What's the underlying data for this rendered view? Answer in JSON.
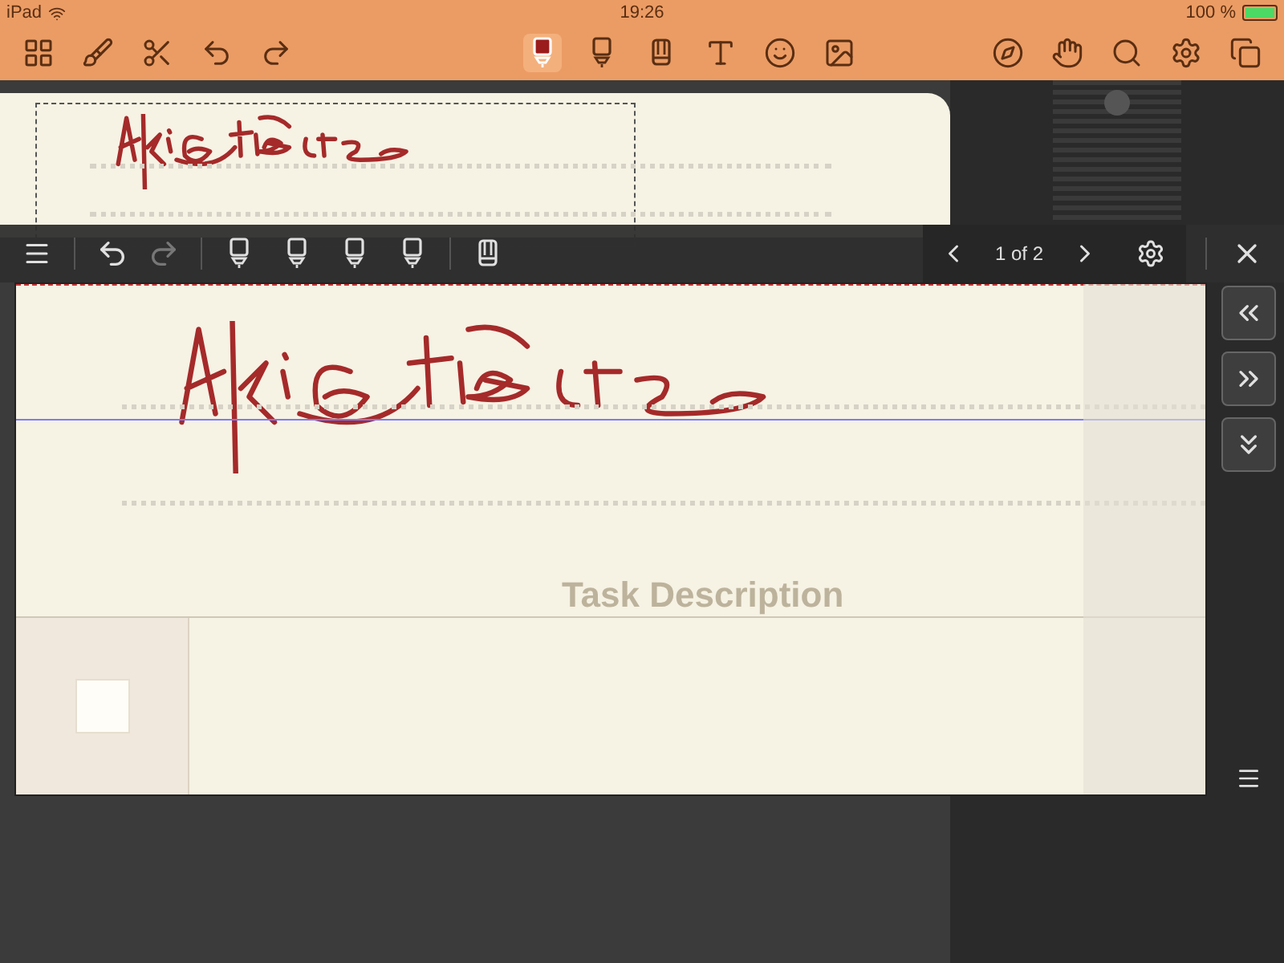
{
  "status_bar": {
    "carrier": "iPad",
    "time": "19:26",
    "battery": "100 %"
  },
  "main_toolbar": {
    "left": [
      {
        "kind": "grid",
        "selected": false
      },
      {
        "kind": "broom",
        "selected": false
      },
      {
        "kind": "scissors",
        "selected": false
      },
      {
        "kind": "undo",
        "selected": false
      },
      {
        "kind": "redo",
        "selected": false
      }
    ],
    "center": [
      {
        "kind": "pen",
        "selected": true
      },
      {
        "kind": "pen",
        "selected": false
      },
      {
        "kind": "marker",
        "selected": false
      },
      {
        "kind": "text",
        "selected": false
      },
      {
        "kind": "emoji",
        "selected": false
      },
      {
        "kind": "image",
        "selected": false
      }
    ],
    "right": [
      {
        "kind": "compass",
        "selected": false
      },
      {
        "kind": "hand",
        "selected": false
      },
      {
        "kind": "search",
        "selected": false
      },
      {
        "kind": "settings",
        "selected": false
      },
      {
        "kind": "pages",
        "selected": false
      }
    ]
  },
  "zoom_toolbar": {
    "redo_disabled": true,
    "pens": [
      {
        "kind": "pen",
        "selected": false
      },
      {
        "kind": "pen",
        "selected": false
      },
      {
        "kind": "pen",
        "selected": false
      },
      {
        "kind": "pen",
        "selected": false
      },
      {
        "kind": "marker",
        "selected": false
      }
    ],
    "page_indicator": "1 of 2"
  },
  "zoom_panel": {
    "column_header": "Task Description",
    "task_checked": false
  },
  "side_buttons": [
    {
      "kind": "left"
    },
    {
      "kind": "right"
    },
    {
      "kind": "down"
    }
  ]
}
